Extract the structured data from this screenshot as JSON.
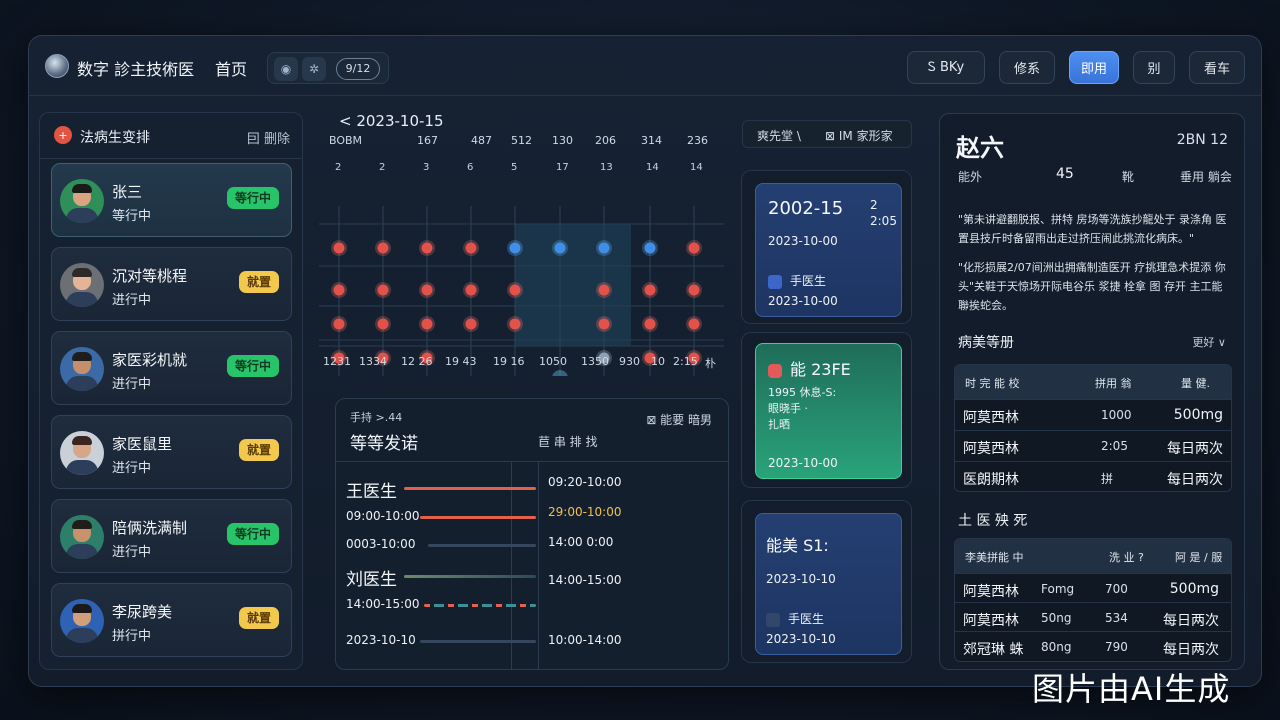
{
  "header": {
    "app_title": "数字 診主技術医",
    "nav_home": "首页",
    "chip": "9/12",
    "btn_search": "Ꮪ BKy",
    "btn_2": "修系",
    "btn_primary": "即用",
    "btn_4": "别",
    "btn_5": "看车"
  },
  "left": {
    "title": "法病生变排",
    "action": "囙 删除",
    "patients": [
      {
        "name": "张三",
        "status": "等行中",
        "badge": "等行中",
        "badge_color": "green",
        "active": true
      },
      {
        "name": "沉对等桃程",
        "status": "进行中",
        "badge": "就置",
        "badge_color": "yellow",
        "active": false
      },
      {
        "name": "家医彩机就",
        "status": "进行中",
        "badge": "等行中",
        "badge_color": "green",
        "active": false
      },
      {
        "name": "家医鼠里",
        "status": "进行中",
        "badge": "就置",
        "badge_color": "yellow",
        "active": false
      },
      {
        "name": "陪俩洗满制",
        "status": "进行中",
        "badge": "等行中",
        "badge_color": "green",
        "active": false
      },
      {
        "name": "李尿跨美",
        "status": "拼行中",
        "badge": "就置",
        "badge_color": "yellow",
        "active": false
      }
    ]
  },
  "schedule": {
    "date": "< 2023-10-15",
    "top_labels": [
      "BOBM",
      "167",
      "487",
      "512",
      "130",
      "206",
      "314",
      "236"
    ],
    "col_numbers": [
      "2",
      "2",
      "3",
      "6",
      "5",
      "17",
      "13",
      "14",
      "14"
    ],
    "bottom_labels": [
      "1231",
      "1334",
      "12 26",
      "19 43",
      "19 16",
      "1050",
      "1350",
      "930",
      "10",
      "2:15",
      "朴"
    ]
  },
  "timeline": {
    "subtitle": "手持 >.44",
    "title": "等等发诺",
    "mid": "苣  串  排  找",
    "right": "⊠ 能要  暗男",
    "rows": [
      {
        "doc": "王医生"
      },
      {
        "left_time": "09:00-10:00"
      },
      {
        "left_time": "0003-10:00"
      },
      {
        "doc": "刘医生"
      },
      {
        "left_time": "14:00-15:00"
      },
      {
        "left_time": "2023-10-10"
      }
    ],
    "right_times": [
      "09:20-10:00",
      "29:00-10:00",
      "14:00  0:00",
      "14:00-15:00",
      "10:00-14:00"
    ]
  },
  "mid_right": {
    "head_left": "爽先堂 \\",
    "head_right": "⊠ IM 家形家",
    "card1": {
      "big": "2002-15",
      "side1": "2",
      "side2": "2:05",
      "date": "2023-10-00",
      "doc": "手医生",
      "date2": "2023-10-00"
    },
    "card2": {
      "big": "能 23FE",
      "l1": "1995 休息-S:",
      "l2": "眼晓手 ·",
      "l3": "扎晒",
      "date": "2023-10-00"
    },
    "card3": {
      "big": "能美  S1:",
      "date": "2023-10-10",
      "doc": "手医生",
      "date2": "2023-10-10"
    }
  },
  "right": {
    "name": "赵六",
    "id": "2BN 12",
    "label1": "能外",
    "age": "45",
    "label2": "靴",
    "label3": "垂用 躺会",
    "para1": "\"第未讲避翻脱报、拼特 房场等洗族抄龍处于 录涤角 医置县技斤时备留雨出走过挤压闹此挑流化病床。\"",
    "para2": "\"化形损展2/07间洲出拥痛制造医开 疗挑理急术提添 你头\"关鞋于天惊场开际电谷乐 浆捷 栓拿 图 存开 主工能聯挨蛇会。",
    "section1": "病美等册",
    "section1_dd": "更好 ∨",
    "table1": {
      "headers": [
        "时 完 能  校",
        "拼用 翁",
        "量  健."
      ],
      "rows": [
        [
          "阿莫西林",
          "1000",
          "500mg"
        ],
        [
          "阿莫西林",
          "2:05",
          "每日两次"
        ],
        [
          "医朗期林",
          "拼",
          "每日两次"
        ]
      ]
    },
    "section2": "土 医 殃 死",
    "table2": {
      "headers": [
        "李美拼能 中",
        "洗 业 ?",
        "阿  是 / 服"
      ],
      "rows": [
        [
          "阿莫西林",
          "Fomg",
          "700",
          "500mg"
        ],
        [
          "阿莫西林",
          "50ng",
          "534",
          "每日两次"
        ],
        [
          "郊冠琳 蛛",
          "80ng",
          "790",
          "每日两次"
        ]
      ]
    }
  },
  "watermark": "图片由AI生成"
}
